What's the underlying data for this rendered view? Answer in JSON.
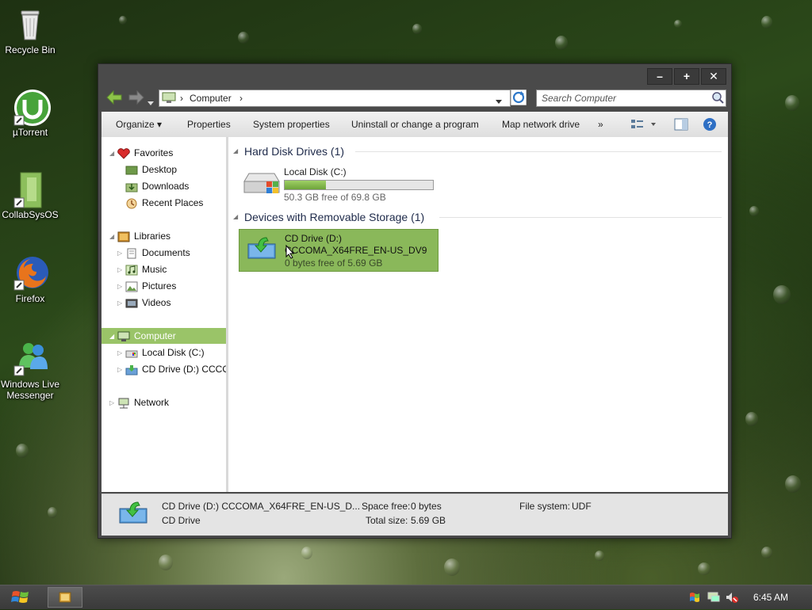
{
  "desktop": {
    "icons": [
      {
        "label": "Recycle Bin",
        "icon": "recycle-bin-icon"
      },
      {
        "label": "µTorrent",
        "icon": "utorrent-icon"
      },
      {
        "label": "CollabSysOS",
        "icon": "collabsysos-icon"
      },
      {
        "label": "Firefox",
        "icon": "firefox-icon"
      },
      {
        "label": "Windows Live Messenger",
        "icon": "windows-live-messenger-icon"
      }
    ]
  },
  "window": {
    "buttons": {
      "minimize": "–",
      "maximize": "+",
      "close": "✕"
    },
    "address": {
      "root_sep": "›",
      "crumb": "Computer",
      "crumb_sep": "›"
    },
    "search": {
      "placeholder": "Search Computer"
    },
    "toolbar": {
      "organize": "Organize ▾",
      "properties": "Properties",
      "system_properties": "System properties",
      "uninstall": "Uninstall or change a program",
      "map_drive": "Map network drive",
      "more": "»"
    },
    "nav": {
      "favorites": "Favorites",
      "desktop": "Desktop",
      "downloads": "Downloads",
      "recent_places": "Recent Places",
      "libraries": "Libraries",
      "documents": "Documents",
      "music": "Music",
      "pictures": "Pictures",
      "videos": "Videos",
      "computer": "Computer",
      "local_disk": "Local Disk (C:)",
      "cd_drive": "CD Drive (D:) CCCOI",
      "network": "Network"
    },
    "groups": {
      "hdd": {
        "title": "Hard Disk Drives (1)"
      },
      "removable": {
        "title": "Devices with Removable Storage (1)"
      }
    },
    "drives": {
      "c": {
        "name": "Local Disk (C:)",
        "free_text": "50.3 GB free of 69.8 GB",
        "used_fraction": 0.28
      },
      "d": {
        "name": "CD Drive (D:)",
        "label": "CCCOMA_X64FRE_EN-US_DV9",
        "free_text": "0 bytes free of 5.69 GB"
      }
    },
    "status": {
      "title": "CD Drive (D:) CCCOMA_X64FRE_EN-US_D...",
      "type": "CD Drive",
      "space_free_label": "Space free:",
      "space_free_value": "0 bytes",
      "total_size_label": "Total size:",
      "total_size_value": "5.69 GB",
      "fs_label": "File system:",
      "fs_value": "UDF"
    }
  },
  "taskbar": {
    "clock": "6:45 AM"
  },
  "colors": {
    "selection_green": "#8ab85a",
    "progress_green": "#7cb843",
    "nav_selected": "#9ac468"
  }
}
